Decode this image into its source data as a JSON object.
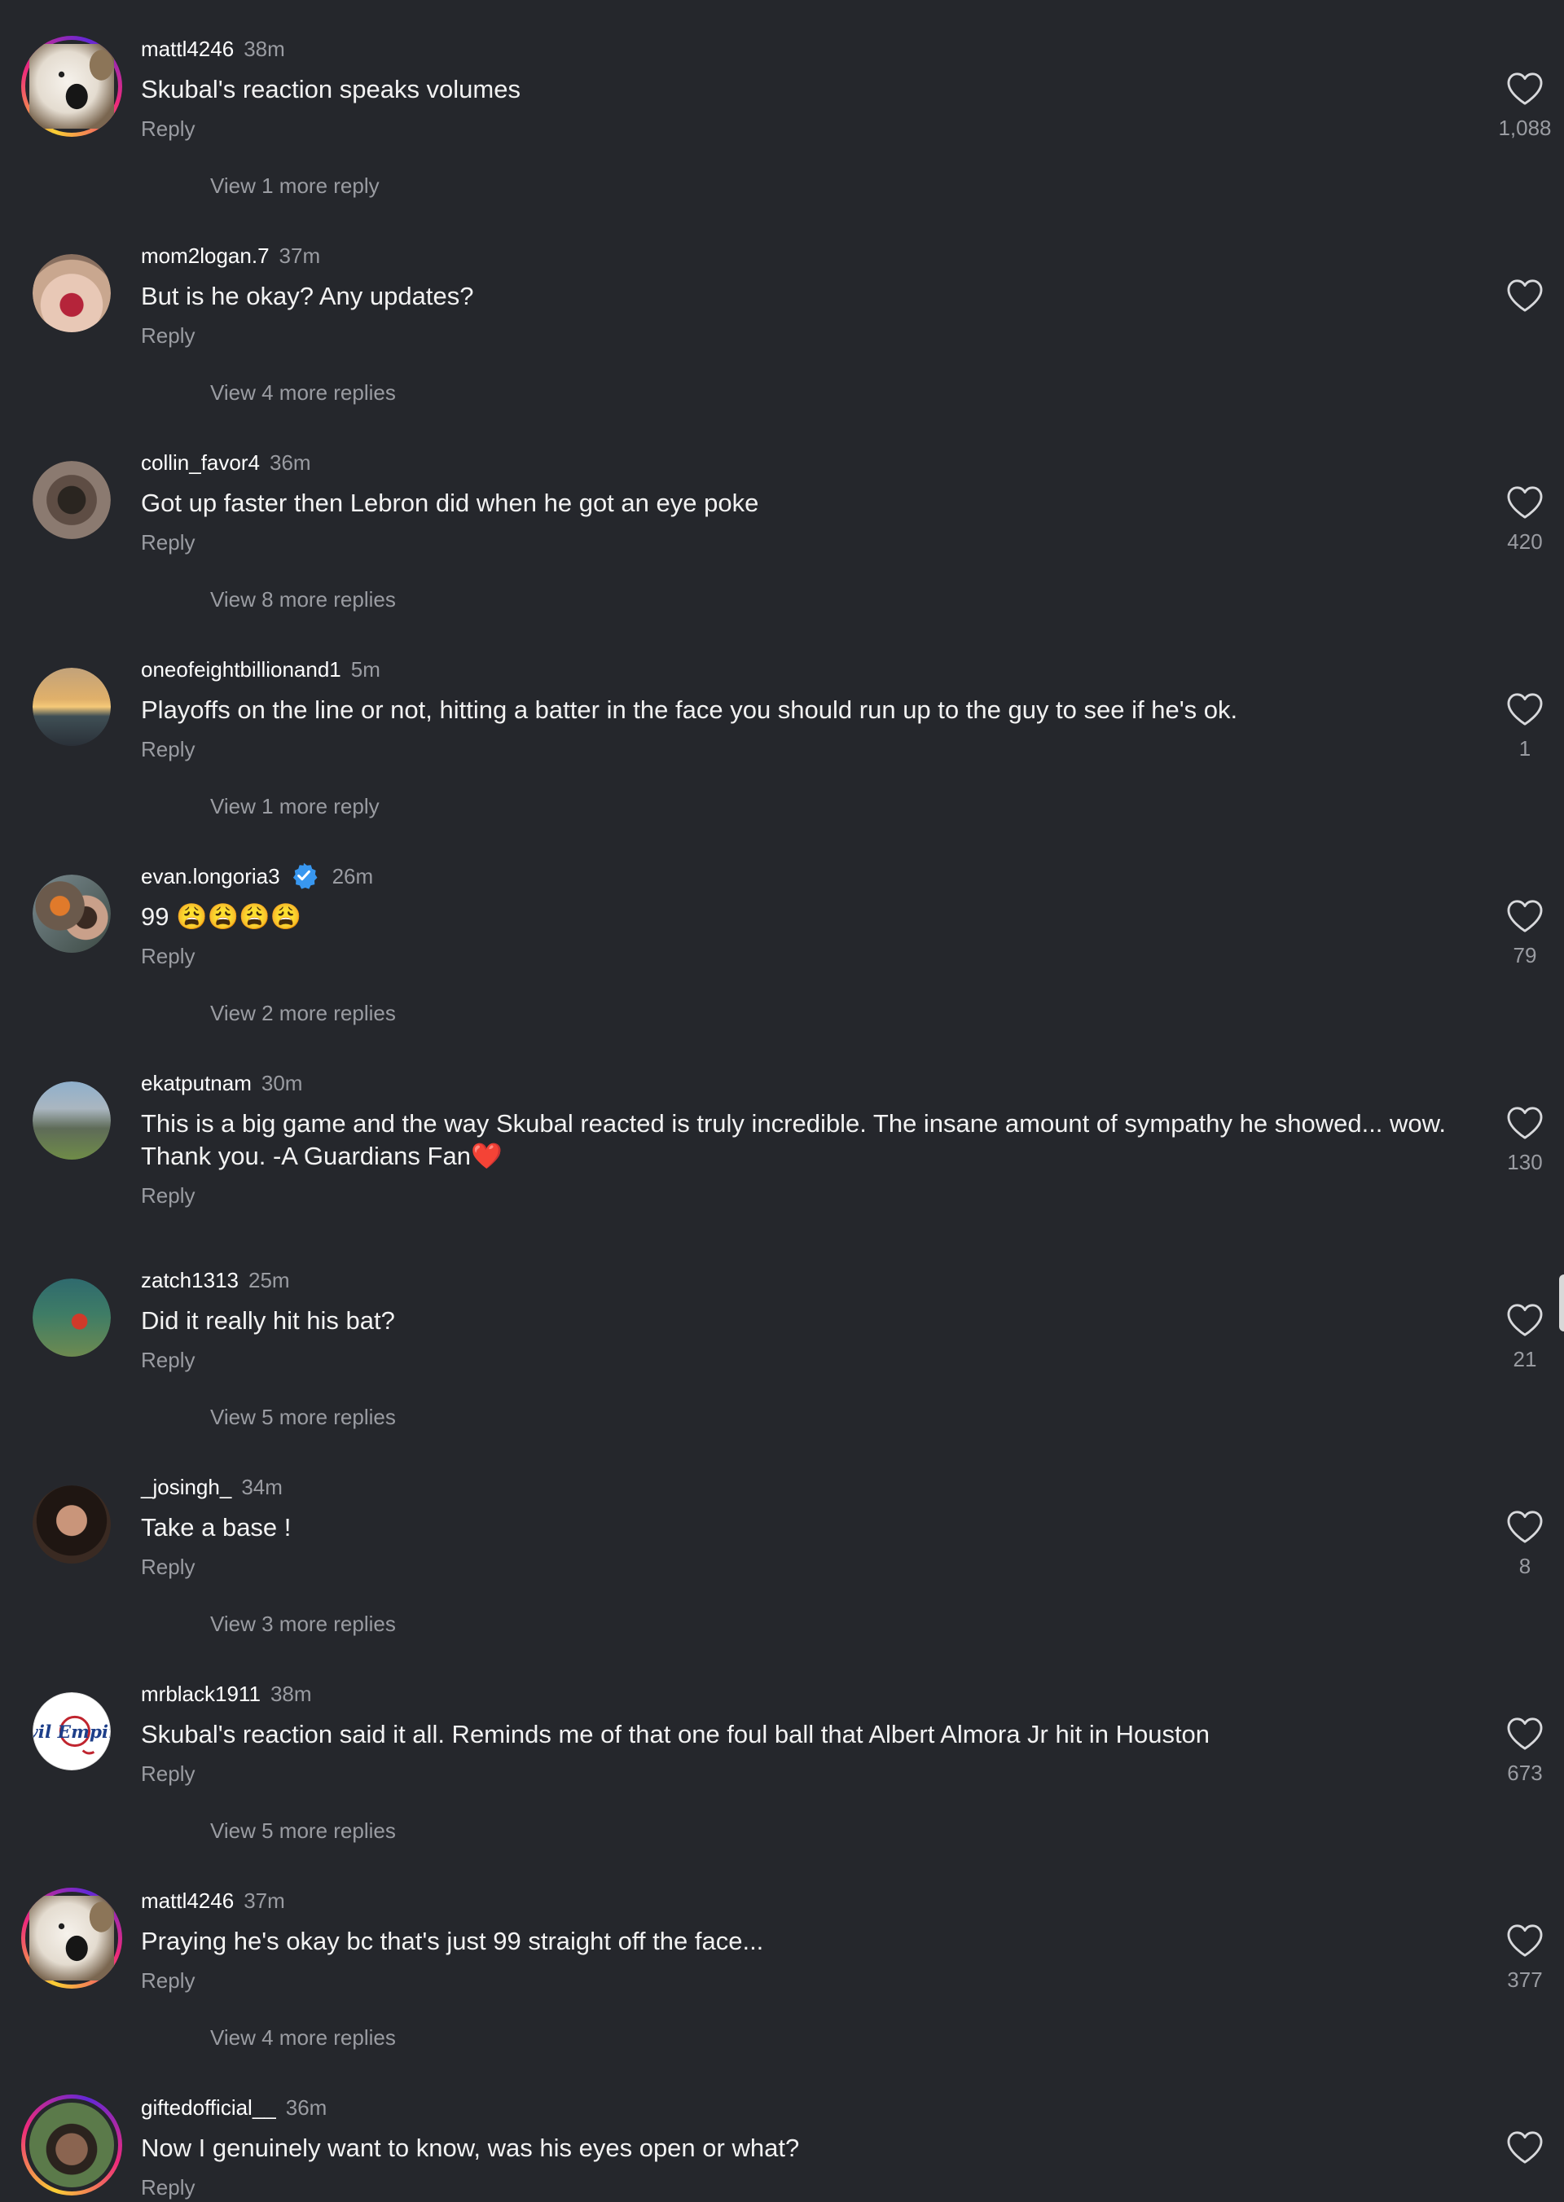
{
  "reply_label": "Reply",
  "colors": {
    "background": "#25272c",
    "secondary_text": "#9a9ca2",
    "verified_blue": "#3897f0",
    "heart_red": "#e0303c"
  },
  "comments": [
    {
      "username": "mattl4246",
      "time": "38m",
      "text": "Skubal's reaction speaks volumes",
      "likes": "1,088",
      "view_more": "View 1 more reply",
      "avatar": "white-dog-avatar",
      "story_ring": true
    },
    {
      "username": "mom2logan.7",
      "time": "37m",
      "text": "But is he okay? Any updates?",
      "likes": "",
      "view_more": "View 4 more replies",
      "avatar": "selfie-avatar",
      "story_ring": false
    },
    {
      "username": "collin_favor4",
      "time": "36m",
      "text": "Got up faster then Lebron did when he got an eye poke",
      "likes": "420",
      "view_more": "View 8 more replies",
      "avatar": "dog-avatar",
      "story_ring": false
    },
    {
      "username": "oneofeightbillionand1",
      "time": "5m",
      "text": "Playoffs on the line or not, hitting a batter in the face you should run up to the guy to see if he's ok.",
      "likes": "1",
      "view_more": "View 1 more reply",
      "avatar": "sunset-avatar",
      "story_ring": false
    },
    {
      "username": "evan.longoria3",
      "verified": true,
      "time": "26m",
      "text": "99 😩😩😩😩",
      "likes": "79",
      "view_more": "View 2 more replies",
      "avatar": "couple-avatar",
      "story_ring": false
    },
    {
      "username": "ekatputnam",
      "time": "30m",
      "text": "This is a big game and the way Skubal reacted is truly incredible. The insane amount of sympathy he showed... wow.\nThank you. -A Guardians Fan❤️",
      "likes": "130",
      "view_more": "",
      "avatar": "stadium-avatar",
      "story_ring": false
    },
    {
      "username": "zatch1313",
      "time": "25m",
      "text": "Did it really hit his bat?",
      "likes": "21",
      "view_more": "View 5 more replies",
      "avatar": "ballpark-avatar",
      "story_ring": false
    },
    {
      "username": "_josingh_",
      "time": "34m",
      "text": "Take a base !",
      "likes": "8",
      "view_more": "View 3 more replies",
      "avatar": "portrait-avatar",
      "story_ring": false
    },
    {
      "username": "mrblack1911",
      "time": "38m",
      "text": "Skubal's reaction said it all. Reminds me of that one foul ball that Albert Almora Jr hit in Houston",
      "likes": "673",
      "view_more": "View 5 more replies",
      "avatar": "evil-empire-logo-avatar",
      "avatar_text": "Evil Empire",
      "story_ring": false
    },
    {
      "username": "mattl4246",
      "time": "37m",
      "text": "Praying he's okay bc that's just 99 straight off the face...",
      "likes": "377",
      "view_more": "View 4 more replies",
      "avatar": "white-dog-avatar",
      "story_ring": true
    },
    {
      "username": "giftedofficial__",
      "time": "36m",
      "text": "Now I genuinely want to know, was his eyes open or what?",
      "likes": "",
      "view_more": "",
      "avatar": "man-avatar",
      "story_ring": true
    }
  ]
}
